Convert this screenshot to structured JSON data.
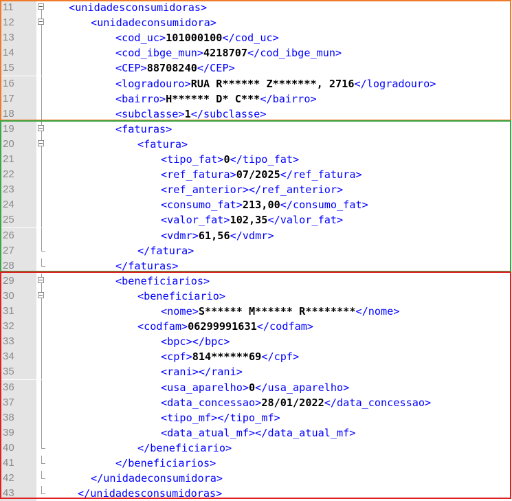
{
  "editor": {
    "lines": [
      {
        "n": "11",
        "segs": [
          {
            "t": "t",
            "s": "<unidadesconsumidoras>"
          }
        ]
      },
      {
        "n": "12",
        "segs": [
          {
            "t": "t",
            "s": "<unidadeconsumidora>"
          }
        ]
      },
      {
        "n": "13",
        "segs": [
          {
            "t": "t",
            "s": "<cod_uc>"
          },
          {
            "t": "v",
            "s": "101000100"
          },
          {
            "t": "t",
            "s": "</cod_uc>"
          }
        ]
      },
      {
        "n": "14",
        "segs": [
          {
            "t": "t",
            "s": "<cod_ibge_mun>"
          },
          {
            "t": "v",
            "s": "4218707"
          },
          {
            "t": "t",
            "s": "</cod_ibge_mun>"
          }
        ]
      },
      {
        "n": "15",
        "segs": [
          {
            "t": "t",
            "s": "<CEP>"
          },
          {
            "t": "v",
            "s": "88708240"
          },
          {
            "t": "t",
            "s": "</CEP>"
          }
        ]
      },
      {
        "n": "16",
        "segs": [
          {
            "t": "t",
            "s": "<logradouro>"
          },
          {
            "t": "v",
            "s": "RUA R****** Z*******, 2716"
          },
          {
            "t": "t",
            "s": "</logradouro>"
          }
        ]
      },
      {
        "n": "17",
        "segs": [
          {
            "t": "t",
            "s": "<bairro>"
          },
          {
            "t": "v",
            "s": "H****** D* C***"
          },
          {
            "t": "t",
            "s": "</bairro>"
          }
        ]
      },
      {
        "n": "18",
        "segs": [
          {
            "t": "t",
            "s": "<subclasse>"
          },
          {
            "t": "v",
            "s": "1"
          },
          {
            "t": "t",
            "s": "</subclasse>"
          }
        ]
      },
      {
        "n": "19",
        "segs": [
          {
            "t": "t",
            "s": "<faturas>"
          }
        ]
      },
      {
        "n": "20",
        "segs": [
          {
            "t": "t",
            "s": "<fatura>"
          }
        ]
      },
      {
        "n": "21",
        "segs": [
          {
            "t": "t",
            "s": "<tipo_fat>"
          },
          {
            "t": "v",
            "s": "0"
          },
          {
            "t": "t",
            "s": "</tipo_fat>"
          }
        ]
      },
      {
        "n": "22",
        "segs": [
          {
            "t": "t",
            "s": "<ref_fatura>"
          },
          {
            "t": "v",
            "s": "07/2025"
          },
          {
            "t": "t",
            "s": "</ref_fatura>"
          }
        ]
      },
      {
        "n": "23",
        "segs": [
          {
            "t": "t",
            "s": "<ref_anterior></ref_anterior>"
          }
        ]
      },
      {
        "n": "24",
        "segs": [
          {
            "t": "t",
            "s": "<consumo_fat>"
          },
          {
            "t": "v",
            "s": "213,00"
          },
          {
            "t": "t",
            "s": "</consumo_fat>"
          }
        ]
      },
      {
        "n": "25",
        "segs": [
          {
            "t": "t",
            "s": "<valor_fat>"
          },
          {
            "t": "v",
            "s": "102,35"
          },
          {
            "t": "t",
            "s": "</valor_fat>"
          }
        ]
      },
      {
        "n": "26",
        "segs": [
          {
            "t": "t",
            "s": "<vdmr>"
          },
          {
            "t": "v",
            "s": "61,56"
          },
          {
            "t": "t",
            "s": "</vdmr>"
          }
        ]
      },
      {
        "n": "27",
        "segs": [
          {
            "t": "t",
            "s": "</fatura>"
          }
        ]
      },
      {
        "n": "28",
        "segs": [
          {
            "t": "t",
            "s": "</faturas>"
          }
        ]
      },
      {
        "n": "29",
        "segs": [
          {
            "t": "t",
            "s": "<beneficiarios>"
          }
        ]
      },
      {
        "n": "30",
        "segs": [
          {
            "t": "t",
            "s": "<beneficiario>"
          }
        ]
      },
      {
        "n": "31",
        "segs": [
          {
            "t": "t",
            "s": "<nome>"
          },
          {
            "t": "v",
            "s": "S****** M****** R********"
          },
          {
            "t": "t",
            "s": "</nome>"
          }
        ]
      },
      {
        "n": "32",
        "segs": [
          {
            "t": "t",
            "s": "<codfam>"
          },
          {
            "t": "v",
            "s": "06299991631"
          },
          {
            "t": "t",
            "s": "</codfam>"
          }
        ]
      },
      {
        "n": "33",
        "segs": [
          {
            "t": "t",
            "s": "<bpc></bpc>"
          }
        ]
      },
      {
        "n": "34",
        "segs": [
          {
            "t": "t",
            "s": "<cpf>"
          },
          {
            "t": "v",
            "s": "814******69"
          },
          {
            "t": "t",
            "s": "</cpf>"
          }
        ]
      },
      {
        "n": "35",
        "segs": [
          {
            "t": "t",
            "s": "<rani></rani>"
          }
        ]
      },
      {
        "n": "36",
        "segs": [
          {
            "t": "t",
            "s": "<usa_aparelho>"
          },
          {
            "t": "v",
            "s": "0"
          },
          {
            "t": "t",
            "s": "</usa_aparelho>"
          }
        ]
      },
      {
        "n": "37",
        "segs": [
          {
            "t": "t",
            "s": "<data_concessao>"
          },
          {
            "t": "v",
            "s": "28/01/2022"
          },
          {
            "t": "t",
            "s": "</data_concessao>"
          }
        ]
      },
      {
        "n": "38",
        "segs": [
          {
            "t": "t",
            "s": "<tipo_mf></tipo_mf>"
          }
        ]
      },
      {
        "n": "39",
        "segs": [
          {
            "t": "t",
            "s": "<data_atual_mf></data_atual_mf>"
          }
        ]
      },
      {
        "n": "40",
        "segs": [
          {
            "t": "t",
            "s": "</beneficiario>"
          }
        ]
      },
      {
        "n": "41",
        "segs": [
          {
            "t": "t",
            "s": "</beneficiarios>"
          }
        ]
      },
      {
        "n": "42",
        "segs": [
          {
            "t": "t",
            "s": "</unidadeconsumidora>"
          }
        ]
      },
      {
        "n": "43",
        "segs": [
          {
            "t": "t",
            "s": "</unidadesconsumidoras>"
          }
        ]
      }
    ]
  },
  "highlight_colors": {
    "unit": "#f07a28",
    "invoices": "#3aa646",
    "beneficiaries": "#e02020"
  }
}
